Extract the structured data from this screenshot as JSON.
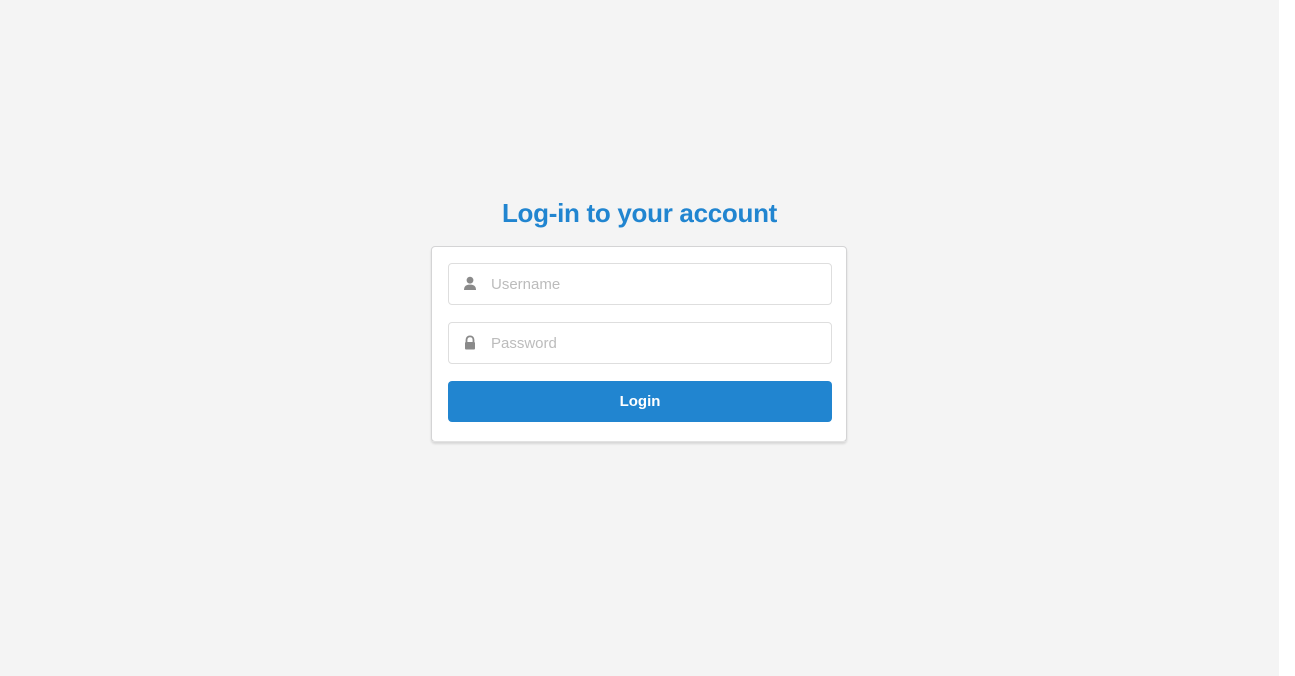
{
  "colors": {
    "accent": "#2185d0",
    "background": "#f4f4f4",
    "card": "#ffffff",
    "icon": "#8a8a8a"
  },
  "header": {
    "title": "Log-in to your account"
  },
  "form": {
    "username": {
      "icon": "user-icon",
      "placeholder": "Username",
      "value": ""
    },
    "password": {
      "icon": "lock-icon",
      "placeholder": "Password",
      "value": ""
    },
    "submit_label": "Login"
  }
}
